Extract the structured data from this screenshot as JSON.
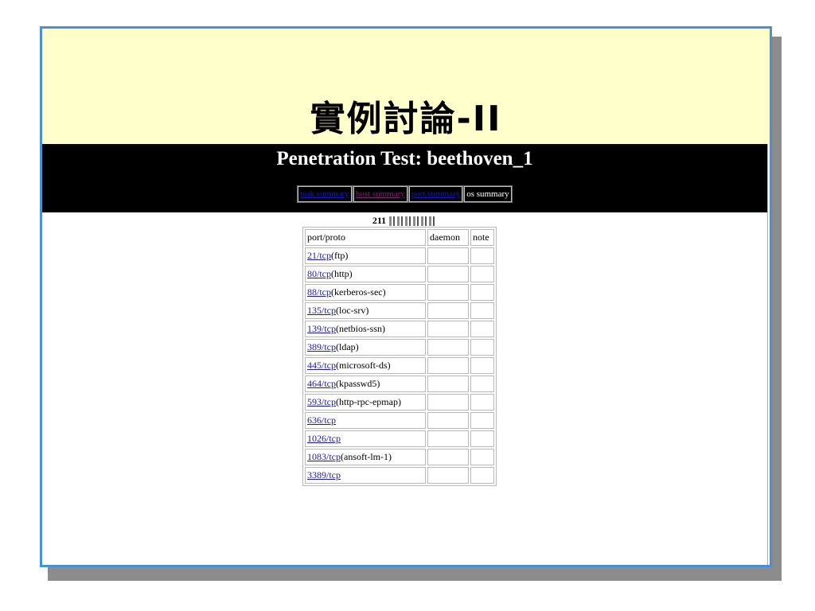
{
  "slide": {
    "title": "實例討論-II"
  },
  "report": {
    "title": "Penetration Test: beethoven_1",
    "tabs": [
      {
        "label": "task summary",
        "state": "link"
      },
      {
        "label": "host summary",
        "state": "visited"
      },
      {
        "label": "port summary",
        "state": "link"
      },
      {
        "label": "os summary",
        "state": "current"
      }
    ],
    "host_prefix": "211",
    "table": {
      "headers": [
        "port/proto",
        "daemon",
        "note"
      ],
      "rows": [
        {
          "port": "21/tcp",
          "service": "(ftp)"
        },
        {
          "port": "80/tcp",
          "service": "(http)"
        },
        {
          "port": "88/tcp",
          "service": "(kerberos-sec)"
        },
        {
          "port": "135/tcp",
          "service": "(loc-srv)"
        },
        {
          "port": "139/tcp",
          "service": "(netbios-ssn)"
        },
        {
          "port": "389/tcp",
          "service": "(ldap)"
        },
        {
          "port": "445/tcp",
          "service": "(microsoft-ds)"
        },
        {
          "port": "464/tcp",
          "service": "(kpasswd5)"
        },
        {
          "port": "593/tcp",
          "service": "(http-rpc-epmap)"
        },
        {
          "port": "636/tcp",
          "service": ""
        },
        {
          "port": "1026/tcp",
          "service": ""
        },
        {
          "port": "1083/tcp",
          "service": "(ansoft-lm-1)"
        },
        {
          "port": "3389/tcp",
          "service": ""
        }
      ]
    }
  },
  "colors": {
    "title_background": "#ffffcc",
    "slide_border": "#4a90d9",
    "header_background": "#000000",
    "link": "#1a1aa6",
    "visited_link": "#7a2a6a"
  }
}
